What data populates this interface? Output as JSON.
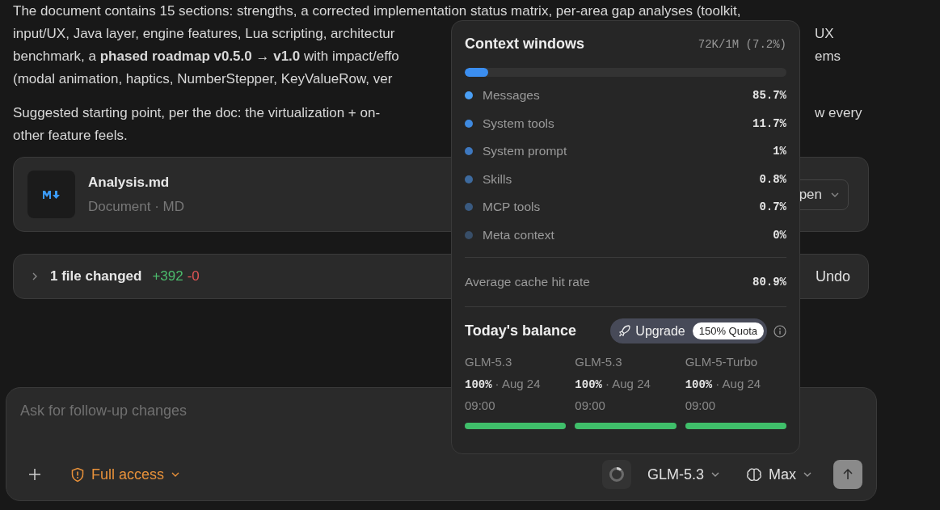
{
  "message": {
    "lines": [
      {
        "left": "The document contains 15 sections: strengths, a corrected implementation status matrix, per-area gap analyses (toolkit,",
        "kind": "clipped"
      },
      {
        "left": "input/UX, Java layer, engine features, Lua scripting, architectur",
        "right": "UX",
        "kind": "line"
      },
      {
        "left": "benchmark, a **phased roadmap v0.5.0 → v1.0** with impact/effo",
        "right": "ems",
        "kind": "line"
      },
      {
        "left": "(modal animation, haptics, NumberStepper, KeyValueRow, ver",
        "kind": "line"
      },
      {
        "left": "Suggested starting point, per the doc: the virtualization + on-",
        "right": "w every",
        "kind": "gap"
      },
      {
        "left": "other feature feels.",
        "kind": "line"
      }
    ]
  },
  "attachment": {
    "name": "Analysis.md",
    "meta": "Document · MD",
    "open_button": "pen"
  },
  "changes": {
    "expanded": false,
    "label": "1 file changed",
    "added": "+392",
    "removed": "-0",
    "undo": "Undo"
  },
  "composer": {
    "placeholder": "Ask for follow-up changes",
    "access": "Full access",
    "model": "GLM-5.3",
    "effort": "Max"
  },
  "context_popover": {
    "title": "Context windows",
    "usage": "72K/1M (7.2%)",
    "level": 0.072,
    "items": [
      {
        "label": "Messages",
        "value": "85.7%",
        "color": "#4a9ff5"
      },
      {
        "label": "System tools",
        "value": "11.7%",
        "color": "#3f8ae0"
      },
      {
        "label": "System prompt",
        "value": "1%",
        "color": "#3e78bf"
      },
      {
        "label": "Skills",
        "value": "0.8%",
        "color": "#3d6a9e"
      },
      {
        "label": "MCP tools",
        "value": "0.7%",
        "color": "#3a5a80"
      },
      {
        "label": "Meta context",
        "value": "0%",
        "color": "#384e68"
      }
    ],
    "cache_label": "Average cache hit rate",
    "cache_value": "80.9%",
    "balance_title": "Today's balance",
    "upgrade": "Upgrade",
    "quota": "150% Quota",
    "balances": [
      {
        "model": "GLM-5.3",
        "percent": "100%",
        "date": "· Aug 24",
        "time": "09:00",
        "level": 1
      },
      {
        "model": "GLM-5.3",
        "percent": "100%",
        "date": "· Aug 24",
        "time": "09:00",
        "level": 1
      },
      {
        "model": "GLM-5-Turbo",
        "percent": "100%",
        "date": "· Aug 24",
        "time": "09:00",
        "level": 1
      }
    ]
  }
}
